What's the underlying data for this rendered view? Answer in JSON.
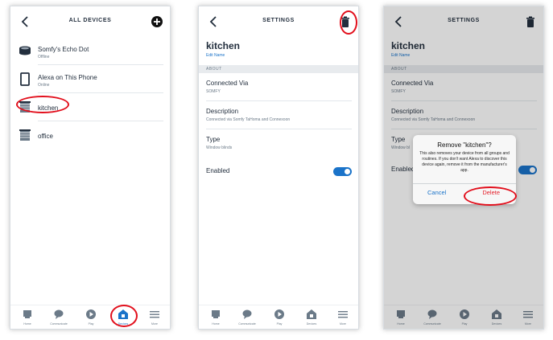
{
  "screen1": {
    "title": "ALL DEVICES",
    "devices": [
      {
        "name": "Somfy's Echo Dot",
        "status": "Offline",
        "icon": "echo-dot-icon"
      },
      {
        "name": "Alexa on This Phone",
        "status": "Online",
        "icon": "phone-icon"
      },
      {
        "name": "kitchen",
        "status": "",
        "icon": "window-blinds-icon"
      },
      {
        "name": "office",
        "status": "",
        "icon": "window-blinds-icon"
      }
    ]
  },
  "screen2": {
    "title": "SETTINGS",
    "device_name": "kitchen",
    "edit_name": "Edit Name",
    "about_header": "ABOUT",
    "connected_via_label": "Connected Via",
    "connected_via_value": "SOMFY",
    "description_label": "Description",
    "description_value": "Connected via Somfy TaHoma and Connexoon",
    "type_label": "Type",
    "type_value": "Window blinds",
    "enabled_label": "Enabled",
    "enabled": true
  },
  "screen3": {
    "title": "SETTINGS",
    "device_name": "kitchen",
    "edit_name": "Edit Name",
    "about_header": "ABOUT",
    "connected_via_label": "Connected Via",
    "connected_via_value": "SOMFY",
    "description_label": "Description",
    "description_value": "Connected via Somfy TaHoma and Connexoon",
    "type_label": "Type",
    "type_value": "Window bl",
    "enabled_label": "Enabled",
    "enabled": true,
    "dialog": {
      "title": "Remove \"kitchen\"?",
      "message": "This also removes your device from all groups and routines. If you don't want Alexa to discover this device again, remove it from the manufacturer's app.",
      "cancel": "Cancel",
      "delete": "Delete"
    }
  },
  "nav": {
    "items": [
      {
        "label": "Home",
        "icon": "home-icon"
      },
      {
        "label": "Communicate",
        "icon": "chat-bubble-icon"
      },
      {
        "label": "Play",
        "icon": "play-icon"
      },
      {
        "label": "Devices",
        "icon": "devices-icon"
      },
      {
        "label": "More",
        "icon": "menu-icon"
      }
    ],
    "active_screen1": "Devices"
  },
  "colors": {
    "accent": "#1a73c9",
    "highlight": "#e20f1c",
    "destructive": "#e5202b",
    "text": "#232f3e"
  }
}
